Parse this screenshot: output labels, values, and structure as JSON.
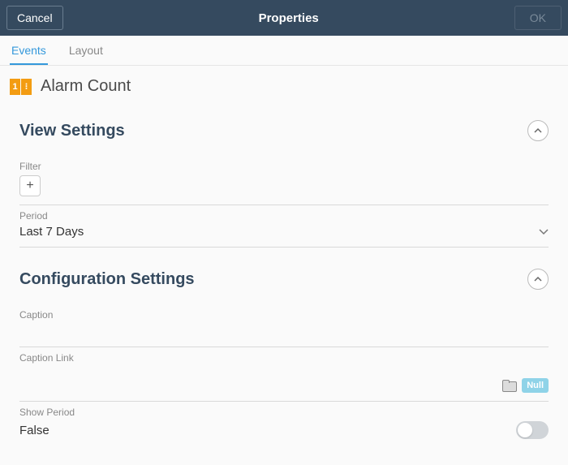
{
  "titlebar": {
    "cancel_label": "Cancel",
    "title": "Properties",
    "ok_label": "OK"
  },
  "tabs": [
    {
      "label": "Events",
      "active": true
    },
    {
      "label": "Layout",
      "active": false
    }
  ],
  "page": {
    "icon_left": "1",
    "icon_right": "⁝",
    "title": "Alarm Count"
  },
  "sections": {
    "view": {
      "title": "View Settings",
      "filter_label": "Filter",
      "period_label": "Period",
      "period_value": "Last 7 Days"
    },
    "config": {
      "title": "Configuration Settings",
      "caption_label": "Caption",
      "caption_value": "",
      "caption_link_label": "Caption Link",
      "null_label": "Null",
      "show_period_label": "Show Period",
      "show_period_value": "False"
    }
  }
}
